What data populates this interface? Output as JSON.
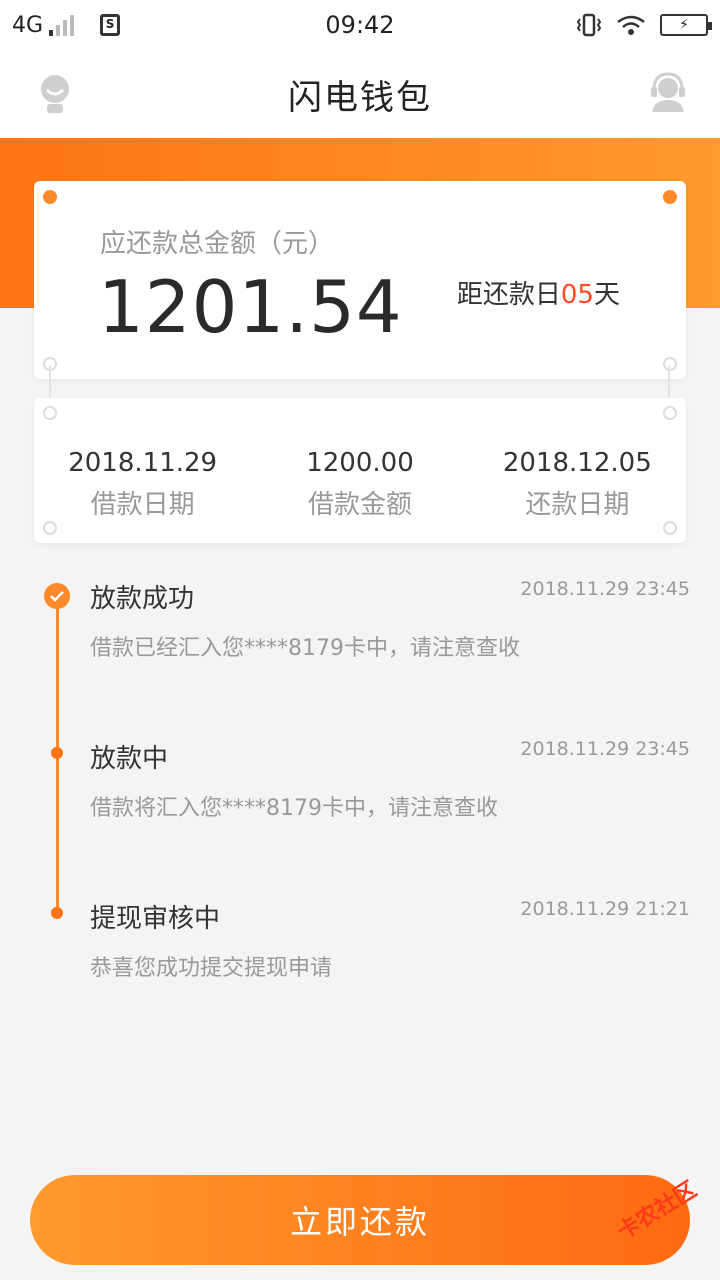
{
  "status_bar": {
    "network": "4G",
    "time": "09:42",
    "sim_label": "S"
  },
  "header": {
    "title": "闪电钱包"
  },
  "summary": {
    "amount_label": "应还款总金额（元）",
    "amount": "1201.54",
    "countdown_prefix": "距还款日",
    "countdown_days": "05",
    "countdown_suffix": "天"
  },
  "loan_info": [
    {
      "value": "2018.11.29",
      "label": "借款日期"
    },
    {
      "value": "1200.00",
      "label": "借款金额"
    },
    {
      "value": "2018.12.05",
      "label": "还款日期"
    }
  ],
  "timeline": [
    {
      "title": "放款成功",
      "time": "2018.11.29 23:45",
      "desc": "借款已经汇入您****8179卡中，请注意查收"
    },
    {
      "title": "放款中",
      "time": "2018.11.29 23:45",
      "desc": "借款将汇入您****8179卡中，请注意查收"
    },
    {
      "title": "提现审核中",
      "time": "2018.11.29 21:21",
      "desc": "恭喜您成功提交提现申请"
    }
  ],
  "pay_button": {
    "label": "立即还款"
  },
  "watermark": {
    "text": "卡农社区"
  },
  "colors": {
    "accent": "#ff8a2a",
    "accent_dark": "#ff6a10",
    "highlight_red": "#ff4a2a"
  }
}
